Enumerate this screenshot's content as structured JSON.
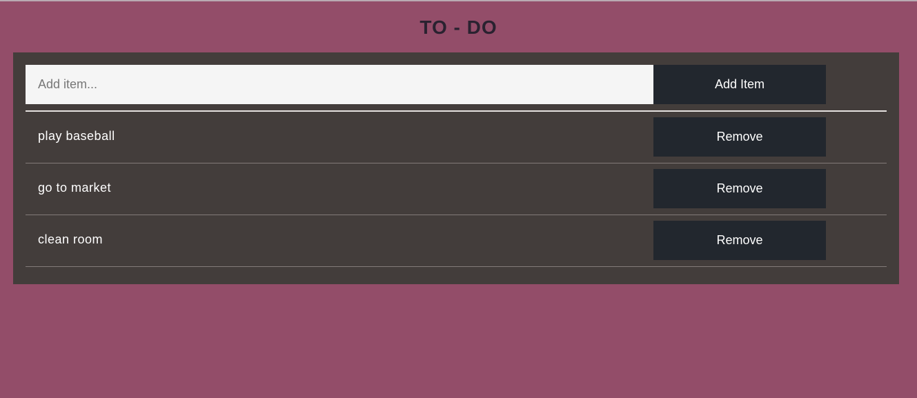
{
  "header": {
    "title": "TO - DO"
  },
  "add_form": {
    "input_value": "",
    "placeholder": "Add item...",
    "add_label": "Add Item"
  },
  "todos": [
    {
      "text": "play baseball",
      "remove_label": "Remove"
    },
    {
      "text": "go to market",
      "remove_label": "Remove"
    },
    {
      "text": "clean room",
      "remove_label": "Remove"
    }
  ],
  "colors": {
    "page_background": "#934d69",
    "panel_background": "#433d3b",
    "button_background": "#22272e",
    "input_background": "#f5f5f5",
    "title_text": "#2a2230"
  }
}
